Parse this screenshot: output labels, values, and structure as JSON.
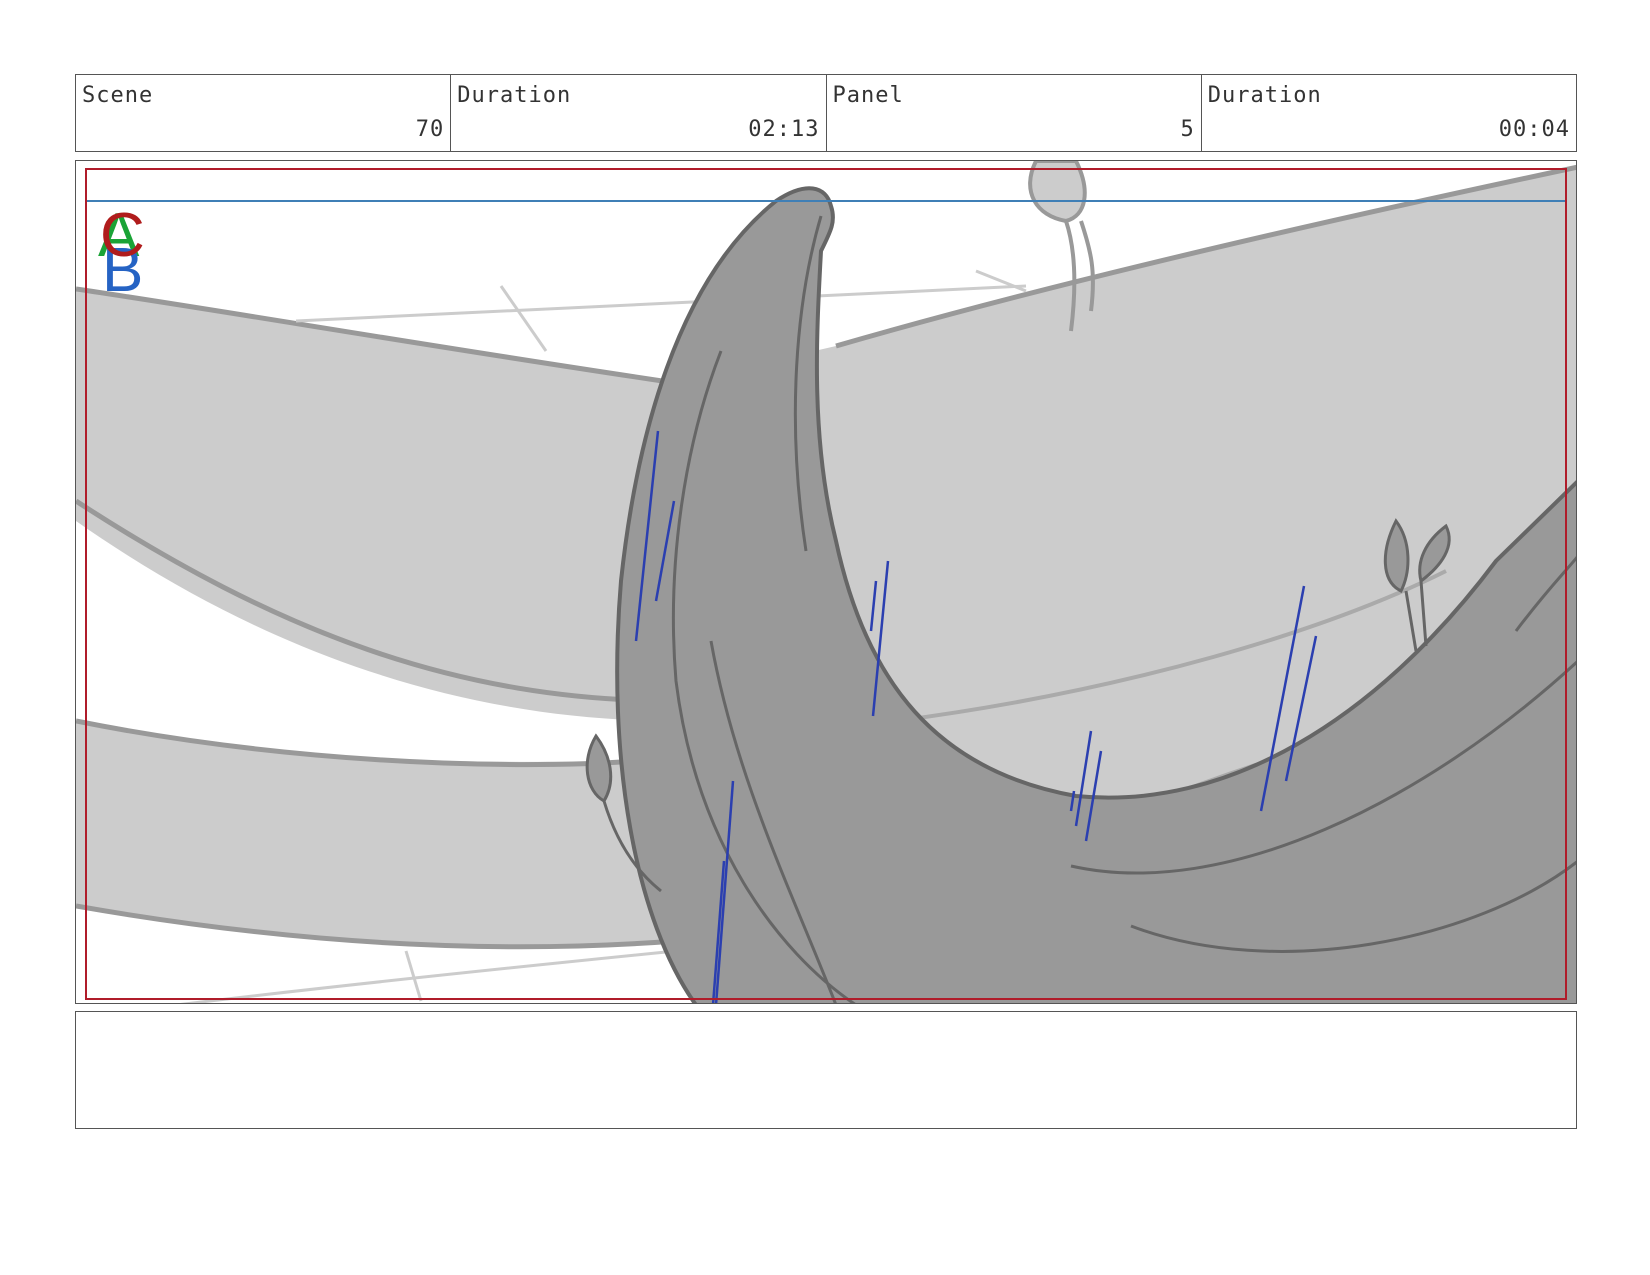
{
  "header": {
    "scene_label": "Scene",
    "scene_value": "70",
    "scene_duration_label": "Duration",
    "scene_duration_value": "02:13",
    "panel_label": "Panel",
    "panel_value": "5",
    "panel_duration_label": "Duration",
    "panel_duration_value": "00:04"
  },
  "layers": {
    "a_label": "A",
    "b_label": "B",
    "c_label": "C"
  },
  "colors": {
    "safe_frame": "#b01c2a",
    "horizon_guide": "#3f7fb6",
    "layer_a": "#1aa336",
    "layer_b": "#2563c4",
    "layer_c": "#b01c1c",
    "motion_lines": "#2b3fb0",
    "branch_light": "#cccccc",
    "branch_dark": "#999999"
  },
  "notes": {
    "text": ""
  }
}
